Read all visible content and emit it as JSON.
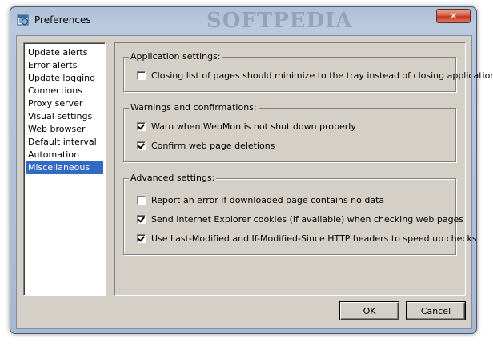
{
  "window": {
    "title": "Preferences",
    "watermark": "SOFTPEDIA",
    "close_glyph": "✕"
  },
  "sidebar": {
    "items": [
      {
        "label": "Update alerts",
        "selected": false
      },
      {
        "label": "Error alerts",
        "selected": false
      },
      {
        "label": "Update logging",
        "selected": false
      },
      {
        "label": "Connections",
        "selected": false
      },
      {
        "label": "Proxy server",
        "selected": false
      },
      {
        "label": "Visual settings",
        "selected": false
      },
      {
        "label": "Web browser",
        "selected": false
      },
      {
        "label": "Default interval",
        "selected": false
      },
      {
        "label": "Automation",
        "selected": false
      },
      {
        "label": "Miscellaneous",
        "selected": true
      }
    ]
  },
  "groups": {
    "application": {
      "title": "Application settings:",
      "options": [
        {
          "label": "Closing list of pages should minimize to the tray instead of closing application",
          "checked": false
        }
      ]
    },
    "warnings": {
      "title": "Warnings and confirmations:",
      "options": [
        {
          "label": "Warn when WebMon is not shut down properly",
          "checked": true
        },
        {
          "label": "Confirm web page deletions",
          "checked": true
        }
      ]
    },
    "advanced": {
      "title": "Advanced settings:",
      "options": [
        {
          "label": "Report an error if downloaded page contains no data",
          "checked": false
        },
        {
          "label": "Send Internet Explorer cookies (if available) when checking web pages",
          "checked": true
        },
        {
          "label": "Use Last-Modified and If-Modified-Since HTTP headers to speed up checks",
          "checked": true
        }
      ]
    }
  },
  "buttons": {
    "ok": "OK",
    "cancel": "Cancel"
  },
  "colors": {
    "selection": "#316ac5",
    "dialog_face": "#d4d0c8"
  }
}
